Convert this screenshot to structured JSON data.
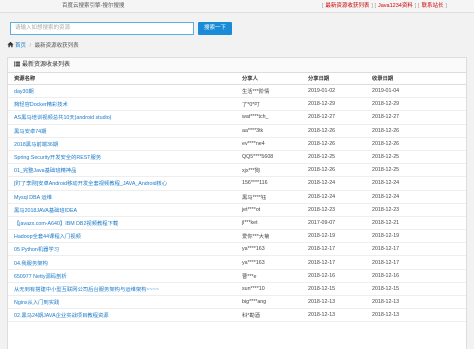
{
  "header": {
    "site_title": "百度云搜索引擎-搜尔搜搜",
    "links": [
      "最新资源收获列表",
      "Java1234资料",
      "联系站长"
    ]
  },
  "search": {
    "placeholder": "请输入如想搜索的资源",
    "button_label": "搜索一下"
  },
  "breadcrumb": {
    "home": "首页",
    "sep": "/",
    "current": "最新资源收获列表"
  },
  "panel": {
    "title": "最新资源收录列表"
  },
  "table": {
    "headers": [
      "资源名称",
      "分享人",
      "分享日期",
      "收录日期"
    ],
    "rows": [
      [
        "day30期",
        "生活***阶情",
        "2019-01-02",
        "2019-01-04"
      ],
      [
        "夠轻容Docker精彩技术",
        "了*0*叮",
        "2018-12-29",
        "2018-12-29"
      ],
      [
        "AS黑马培训视频总共10天(android studio)",
        "wat****tch_",
        "2018-12-27",
        "2018-12-27"
      ],
      [
        "黑马安卓74期",
        "aa****3tk",
        "2018-12-26",
        "2018-12-26"
      ],
      [
        "2018黑马前端36期",
        "ev****ne4",
        "2018-12-26",
        "2018-12-26"
      ],
      [
        "Spring Security开发安全的REST服务",
        "QQ5****5608",
        "2018-12-25",
        "2018-12-25"
      ],
      [
        "01_完整Java基础班精神品",
        "xjx***狗",
        "2018-12-26",
        "2018-12-25"
      ],
      [
        "[盯了李刚]安卓Android移动开发全套视频教程_JAVA_Android核心",
        "156****116",
        "2018-12-24",
        "2018-12-24"
      ],
      [
        "Mysql DBA 运维",
        "黑马****钰",
        "2018-12-24",
        "2018-12-24"
      ],
      [
        "黑马2018JAVA基础班IDEA",
        "jet****ot",
        "2018-12-23",
        "2018-12-23"
      ],
      [
        "【javazx.com-A640】IBM DB2视频教程下载",
        "jl***ket",
        "2017-09-07",
        "2018-12-21"
      ],
      [
        "Hadoop全套44课程入门视频",
        "爱你***大菊",
        "2018-12-19",
        "2018-12-19"
      ],
      [
        "05 Python机器学习",
        "ya****163",
        "2018-12-17",
        "2018-12-17"
      ],
      [
        "04.我服务架构",
        "ya****163",
        "2018-12-17",
        "2018-12-17"
      ],
      [
        "650977 Netty源码剖析",
        "曹***e",
        "2018-12-16",
        "2018-12-16"
      ],
      [
        "从无到有搭建中小型互联网公司后台服务架构与运维架构~~~~",
        "sun****10",
        "2018-12-15",
        "2018-12-15"
      ],
      [
        "Nginx从入门到实践",
        "big****ang",
        "2018-12-13",
        "2018-12-13"
      ],
      [
        "02.黑马24期JAVA企业实战项目教程资源",
        "科*勘酒",
        "2018-12-13",
        "2018-12-13"
      ]
    ]
  },
  "colors": {
    "accent": "#1a8bd6",
    "link": "#1a7ac8",
    "toplink": "#cc0000"
  }
}
